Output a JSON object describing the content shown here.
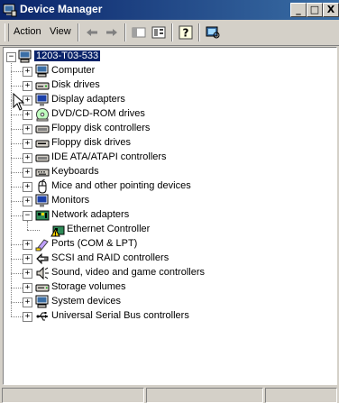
{
  "window": {
    "title": "Device Manager",
    "minimize_label": "_",
    "maximize_label": "□",
    "close_label": "X"
  },
  "menubar": {
    "action_label": "Action",
    "view_label": "View"
  },
  "toolbar": {
    "icons": [
      "back-icon",
      "forward-icon",
      "show-hide-tree-icon",
      "properties-icon",
      "help-icon",
      "scan-hardware-icon"
    ]
  },
  "tree": {
    "root": "1203-T03-533",
    "items": [
      {
        "label": "Computer",
        "icon": "computer-icon",
        "expanded": false
      },
      {
        "label": "Disk drives",
        "icon": "disk-drive-icon",
        "expanded": false
      },
      {
        "label": "Display adapters",
        "icon": "monitor-icon",
        "expanded": false
      },
      {
        "label": "DVD/CD-ROM drives",
        "icon": "cdrom-icon",
        "expanded": false
      },
      {
        "label": "Floppy disk controllers",
        "icon": "controller-icon",
        "expanded": false
      },
      {
        "label": "Floppy disk drives",
        "icon": "floppy-drive-icon",
        "expanded": false
      },
      {
        "label": "IDE ATA/ATAPI controllers",
        "icon": "controller-icon",
        "expanded": false
      },
      {
        "label": "Keyboards",
        "icon": "keyboard-icon",
        "expanded": false
      },
      {
        "label": "Mice and other pointing devices",
        "icon": "mouse-icon",
        "expanded": false
      },
      {
        "label": "Monitors",
        "icon": "monitor-icon",
        "expanded": false
      },
      {
        "label": "Network adapters",
        "icon": "network-adapter-icon",
        "expanded": true,
        "children": [
          {
            "label": "Ethernet Controller",
            "icon": "warning-network-icon"
          }
        ]
      },
      {
        "label": "Ports (COM & LPT)",
        "icon": "port-icon",
        "expanded": false
      },
      {
        "label": "SCSI and RAID controllers",
        "icon": "scsi-icon",
        "expanded": false
      },
      {
        "label": "Sound, video and game controllers",
        "icon": "sound-icon",
        "expanded": false
      },
      {
        "label": "Storage volumes",
        "icon": "storage-icon",
        "expanded": false
      },
      {
        "label": "System devices",
        "icon": "computer-icon",
        "expanded": false
      },
      {
        "label": "Universal Serial Bus controllers",
        "icon": "usb-icon",
        "expanded": false
      }
    ]
  },
  "colors": {
    "titlebar_start": "#0a246a",
    "titlebar_end": "#3a6ea5",
    "selection": "#0a246a",
    "chrome": "#d4d0c8"
  }
}
